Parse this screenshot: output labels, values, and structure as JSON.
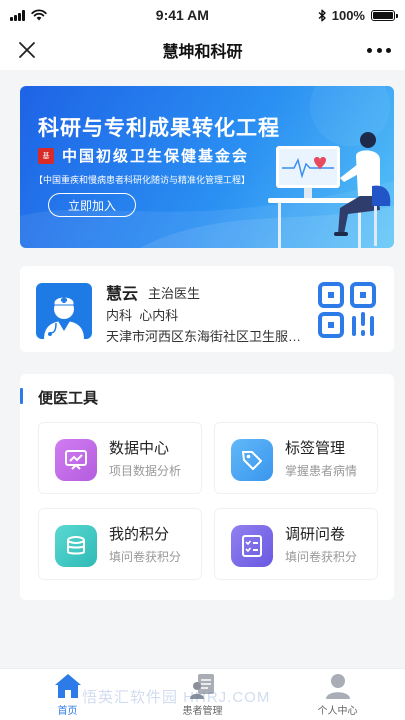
{
  "status_bar": {
    "time": "9:41 AM",
    "battery": "100%",
    "battery_level": 1.0
  },
  "nav": {
    "title": "慧坤和科研",
    "close_icon": "close-icon",
    "more_icon": "more-icon"
  },
  "banner": {
    "title": "科研与专利成果转化工程",
    "org": "中国初级卫生保健基金会",
    "subtitle": "【中国重疾和慢病患者科研化随访与精准化管理工程】",
    "button_label": "立即加入"
  },
  "doctor": {
    "name": "慧云",
    "title": "主治医生",
    "departments": "内科  心内科",
    "organization": "天津市河西区东海街社区卫生服务中心",
    "avatar_icon": "doctor-avatar-icon",
    "qr_icon": "qr-code-icon"
  },
  "tools": {
    "heading": "便医工具",
    "items": [
      {
        "name": "数据中心",
        "desc": "项目数据分析",
        "icon": "chart-icon",
        "color": "#c56ee6"
      },
      {
        "name": "标签管理",
        "desc": "掌握患者病情",
        "icon": "tag-icon",
        "color": "#4aa6f5"
      },
      {
        "name": "我的积分",
        "desc": "填问卷获积分",
        "icon": "coins-icon",
        "color": "#3cc7c2"
      },
      {
        "name": "调研问卷",
        "desc": "填问卷获积分",
        "icon": "checklist-icon",
        "color": "#7b6ae8"
      }
    ]
  },
  "tab_bar": {
    "tabs": [
      {
        "label": "首页",
        "icon": "home-icon",
        "active": true
      },
      {
        "label": "患者管理",
        "icon": "patients-icon",
        "active": false
      },
      {
        "label": "个人中心",
        "icon": "person-icon",
        "active": false
      }
    ]
  },
  "watermark": "悟英汇软件园 HHRJ.COM",
  "colors": {
    "accent": "#2d7be8",
    "banner_start": "#1e63e6",
    "banner_end": "#57c2f7"
  }
}
